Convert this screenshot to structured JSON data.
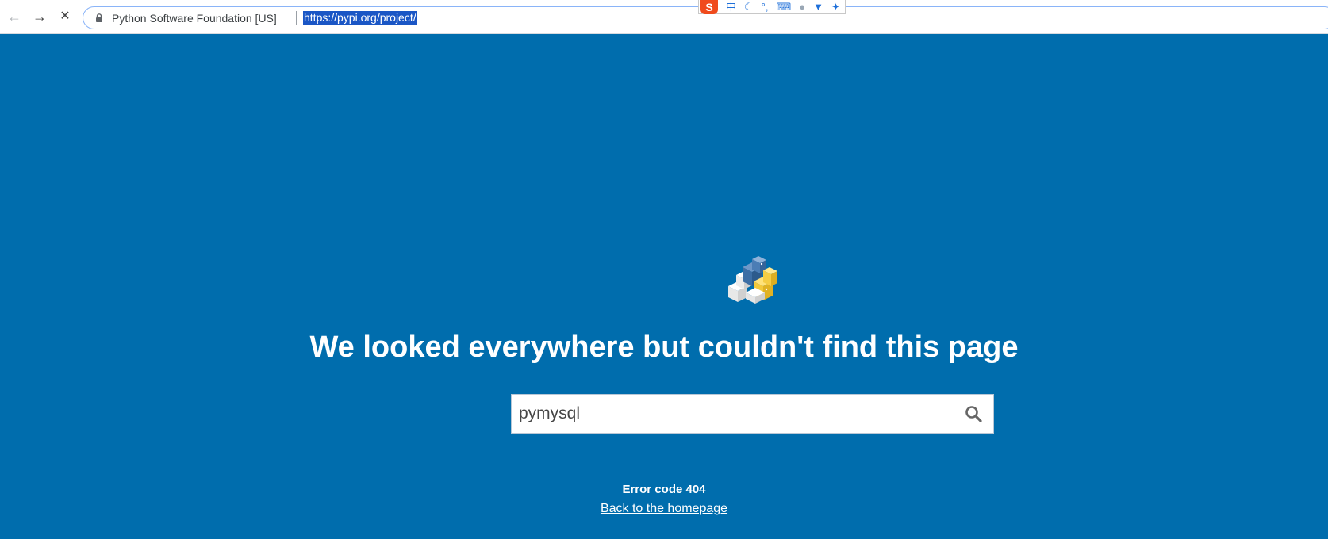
{
  "browser": {
    "site_name": "Python Software Foundation [US]",
    "url": "https://pypi.org/project/",
    "nav_icons": [
      "back-arrow-icon",
      "forward-arrow-icon",
      "stop-loading-icon",
      "lock-icon"
    ]
  },
  "ime_toolbar": {
    "logo": "S",
    "mode": "中",
    "icons": [
      "moon-icon",
      "punctuation-icon",
      "keyboard-icon",
      "user-icon",
      "shirt-icon",
      "wrench-icon"
    ],
    "punctuation": "°,"
  },
  "page": {
    "background_color": "#006dad",
    "headline": "We looked everywhere but couldn't find this page",
    "search": {
      "value": "pymysql",
      "icon": "search-icon"
    },
    "error_code": "Error code 404",
    "home_link": "Back to the homepage",
    "logo": "pypi-logo"
  }
}
